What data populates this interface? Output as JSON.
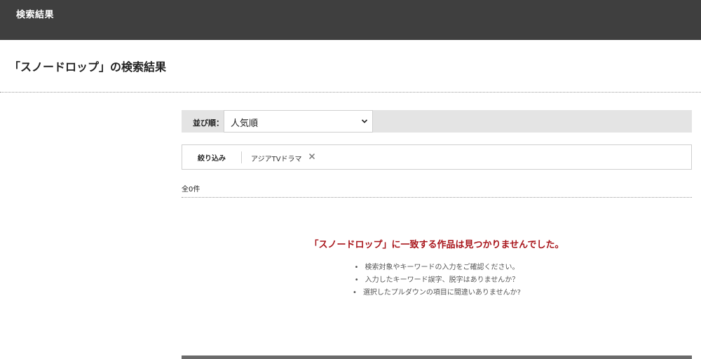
{
  "header": {
    "title": "検索結果"
  },
  "page": {
    "heading": "「スノードロップ」の検索結果"
  },
  "sort": {
    "label": "並び順：",
    "selected": "人気順"
  },
  "filter": {
    "label": "絞り込み",
    "chip": "アジアTVドラマ"
  },
  "results": {
    "count": "全0件",
    "no_result_message": "「スノードロップ」に一致する作品は見つかりませんでした。",
    "hints": [
      "検索対象やキーワードの入力をご確認ください。",
      "入力したキーワード誤字、脱字はありませんか？",
      "選択したプルダウンの項目に間違いありませんか?"
    ]
  },
  "colors": {
    "header_bg": "#3f3f3f",
    "error_text": "#a8141a",
    "bar_bg": "#e4e4e4"
  }
}
